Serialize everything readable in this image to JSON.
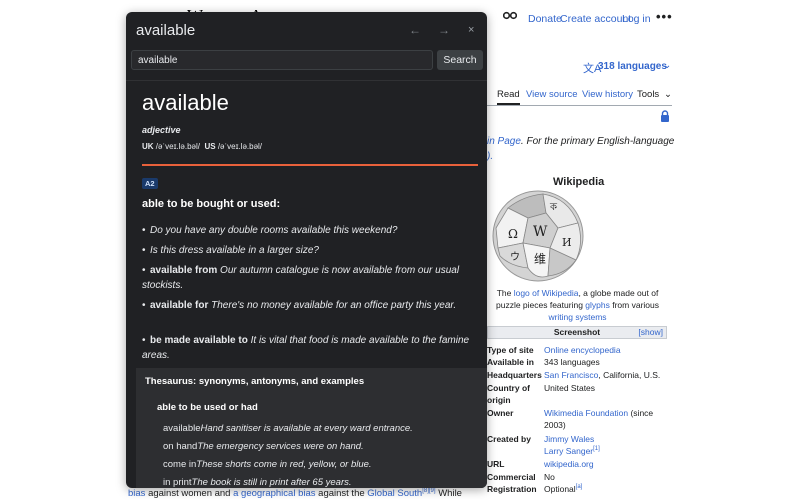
{
  "wiki": {
    "logo_text": "W",
    "logo_text2": "A",
    "top_links": [
      "Donate",
      "Create account",
      "Log in"
    ],
    "more_icon": "more-dots-icon",
    "languages": "318 languages",
    "tabs": [
      "Read",
      "View source",
      "View history",
      "Tools"
    ],
    "hatnote_link": "in Page",
    "hatnote_text": ". For the primary English-language",
    "hatnote_line2": ").",
    "infobox_title": "Wikipedia",
    "caption_1": "The ",
    "caption_link1": "logo of Wikipedia",
    "caption_2": ", a globe made out of",
    "caption_3": "puzzle pieces featuring ",
    "caption_link2": "glyphs",
    "caption_4": " from various",
    "caption_link3": "writing systems",
    "screenshot_label": "Screenshot",
    "show_label": "[show]",
    "rows": [
      {
        "k": "Type of site",
        "v": "Online encyclopedia",
        "link": true
      },
      {
        "k": "Available in",
        "v": "343 languages",
        "link": false
      },
      {
        "k": "Headquarters",
        "v_link": "San Francisco",
        "v": ", California, U.S."
      },
      {
        "k": "Country of",
        "v": "United States",
        "link": false
      },
      {
        "k": "origin",
        "v": "",
        "link": false
      },
      {
        "k": "Owner",
        "v_link": "Wikimedia Foundation",
        "v": " (since"
      },
      {
        "k": "",
        "v": "2003)",
        "link": false
      },
      {
        "k": "Created by",
        "v": "Jimmy Wales",
        "link": true
      },
      {
        "k": "",
        "v": "Larry Sanger",
        "link": true,
        "sup": "[1]"
      },
      {
        "k": "URL",
        "v": "wikipedia.org",
        "link": true
      },
      {
        "k": "Commercial",
        "v": "No",
        "link": false
      },
      {
        "k": "Registration",
        "v": "Optional",
        "link": false,
        "sup": "[a]"
      }
    ],
    "bottom_1": "bias",
    "bottom_2": " against women and ",
    "bottom_3": "a geographical bias",
    "bottom_4": " against the ",
    "bottom_5": "Global South",
    "bottom_sup": "[8][9]",
    "bottom_6": " While"
  },
  "popup": {
    "title": "available",
    "nav_back": "←",
    "nav_forward": "→",
    "close": "×",
    "search_value": "available",
    "search_button": "Search",
    "headword": "available",
    "pos": "adjective",
    "uk_label": "UK",
    "uk_pron": "/əˈveɪ.lə.bəl/",
    "us_label": "US",
    "us_pron": "/əˈveɪ.lə.bəl/",
    "level": "A2",
    "definition": "able to be bought or used:",
    "examples": [
      {
        "bold": "",
        "text": "Do you have any double rooms available this weekend?"
      },
      {
        "bold": "",
        "text": "Is this dress available in a larger size?"
      },
      {
        "bold": "available from",
        "text": "Our autumn catalogue is now available from our usual stockists."
      },
      {
        "bold": "available for",
        "text": "There's no money available for an office party this year."
      },
      {
        "bold": "be made available to",
        "text": "It is vital that food is made available to the famine areas."
      }
    ],
    "thesaurus_title": "Thesaurus: synonyms, antonyms, and examples",
    "thesaurus_sub": "able to be used or had",
    "thesaurus_items": [
      {
        "word": "available",
        "example": "Hand sanitiser is available at every ward entrance."
      },
      {
        "word": "on hand",
        "example": "The emergency services were on hand."
      },
      {
        "word": "come in",
        "example": "These shorts come in red, yellow, or blue."
      },
      {
        "word": "in print",
        "example": "The book is still in print after 65 years."
      }
    ]
  },
  "colors": {
    "popup_bg": "#202124",
    "accent_orange": "#e8613b",
    "link_blue": "#3366cc"
  }
}
